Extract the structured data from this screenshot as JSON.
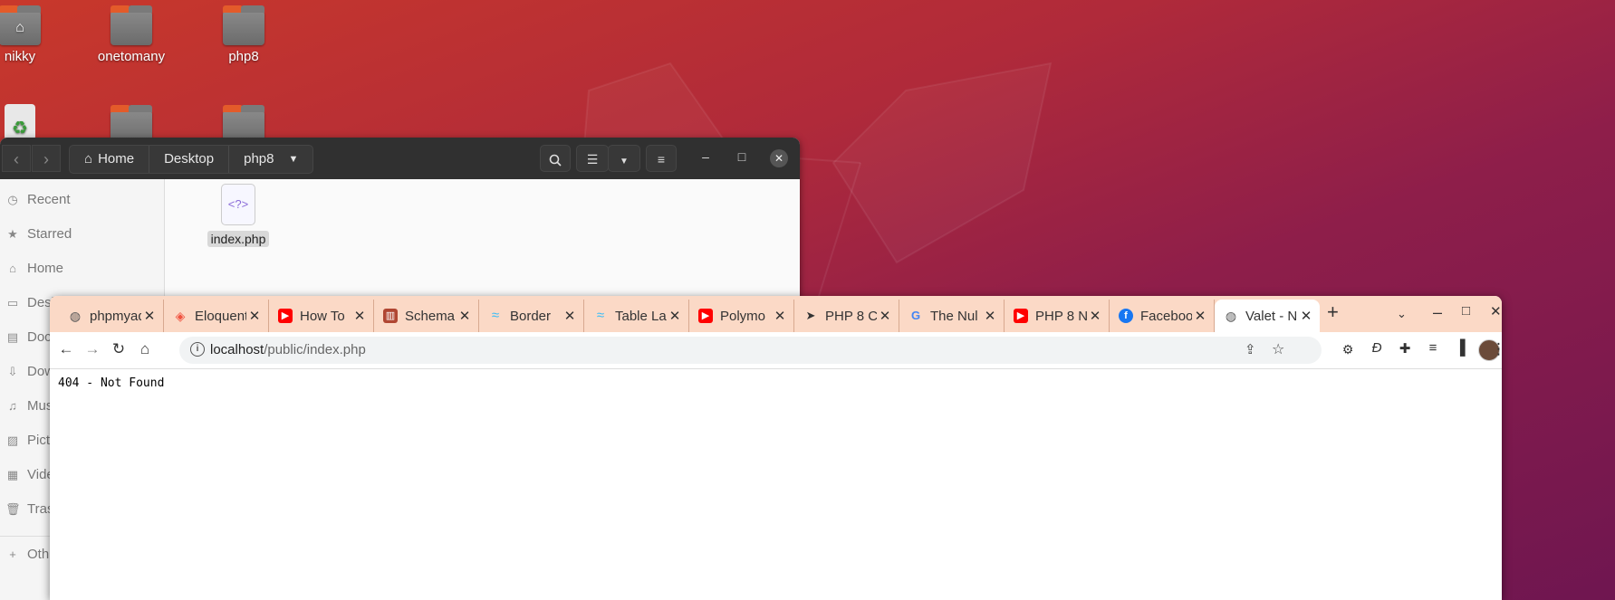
{
  "desktop": {
    "icons": [
      {
        "label": "nikky",
        "kind": "home"
      },
      {
        "label": "onetomany",
        "kind": "folder"
      },
      {
        "label": "php8",
        "kind": "folder"
      }
    ]
  },
  "file_manager": {
    "breadcrumbs": [
      "Home",
      "Desktop",
      "php8"
    ],
    "sidebar": [
      "Recent",
      "Starred",
      "Home",
      "Desk",
      "Docu",
      "Dow",
      "Musi",
      "Pict",
      "Vide",
      "Tras",
      "Oth"
    ],
    "files": [
      {
        "name": "index.php",
        "icon_text": "<?>"
      }
    ]
  },
  "browser": {
    "tabs": [
      {
        "title": "phpmyadmin",
        "icon": "globe-icon",
        "color": "#555555"
      },
      {
        "title": "Eloquent",
        "icon": "laravel-icon",
        "color": "#f05340"
      },
      {
        "title": "How To",
        "icon": "youtube-icon",
        "color": "#ff0000"
      },
      {
        "title": "Schema",
        "icon": "trello-icon",
        "color": "#b04632"
      },
      {
        "title": "Border",
        "icon": "tailwind-icon",
        "color": "#38bdf8"
      },
      {
        "title": "Table La",
        "icon": "tailwind-icon",
        "color": "#38bdf8"
      },
      {
        "title": "Polymo",
        "icon": "youtube-icon",
        "color": "#ff0000"
      },
      {
        "title": "PHP 8 C",
        "icon": "send-icon",
        "color": "#333333"
      },
      {
        "title": "The Nul",
        "icon": "google-icon",
        "color": "#4285f4"
      },
      {
        "title": "PHP 8 N",
        "icon": "youtube-icon",
        "color": "#ff0000"
      },
      {
        "title": "Facebook",
        "icon": "facebook-icon",
        "color": "#1877f2"
      },
      {
        "title": "Valet - N",
        "icon": "globe-icon",
        "color": "#555555"
      }
    ],
    "new_tab": "+",
    "url_host": "localhost",
    "url_path": "/public/index.php",
    "page_text": "404 - Not Found"
  }
}
